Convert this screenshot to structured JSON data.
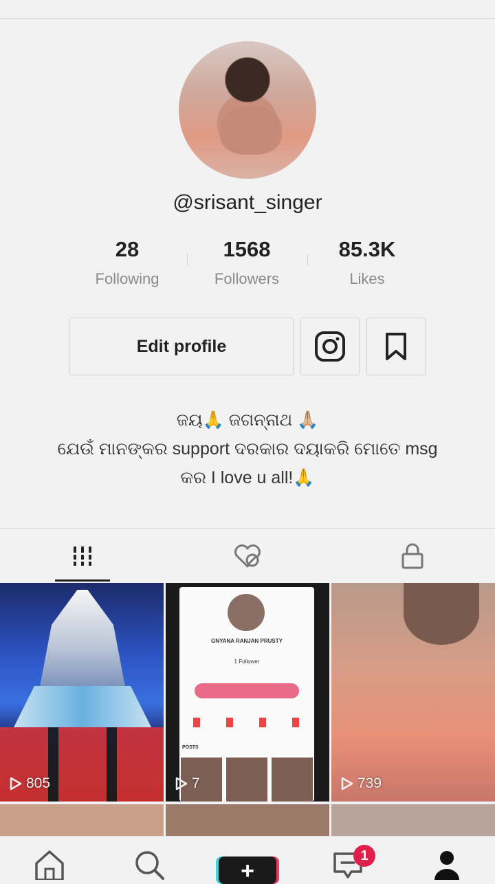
{
  "profile": {
    "username": "@srisant_singer",
    "stats": [
      {
        "value": "28",
        "label": "Following"
      },
      {
        "value": "1568",
        "label": "Followers"
      },
      {
        "value": "85.3K",
        "label": "Likes"
      }
    ],
    "edit_button": "Edit profile",
    "bio_lines": [
      "ଜୟ🙏 ଜଗନ୍ନାଥ 🙏🏼",
      "ଯେଉଁ ମାନଙ୍କର support ଦରକାର ଦୟାକରି ମୋତେ msg",
      "କର I love u all!🙏"
    ]
  },
  "tabs": {
    "icons": [
      "grid-icon",
      "liked-hidden-icon",
      "lock-icon"
    ],
    "active": 0
  },
  "videos": [
    {
      "views": "805"
    },
    {
      "views": "7",
      "inner_name": "GNYANA RANJAN PRUSTY",
      "inner_followers": "1 Follower",
      "inner_posts": "POSTS"
    },
    {
      "views": "739"
    }
  ],
  "nav": {
    "icons": [
      "home-icon",
      "search-icon",
      "create-icon",
      "inbox-icon",
      "profile-icon"
    ],
    "inbox_badge": "1",
    "plus_symbol": "+"
  },
  "colors": {
    "badge": "#e0204a",
    "accent_cyan": "#3dd6e0",
    "accent_red": "#ee3a5e"
  }
}
